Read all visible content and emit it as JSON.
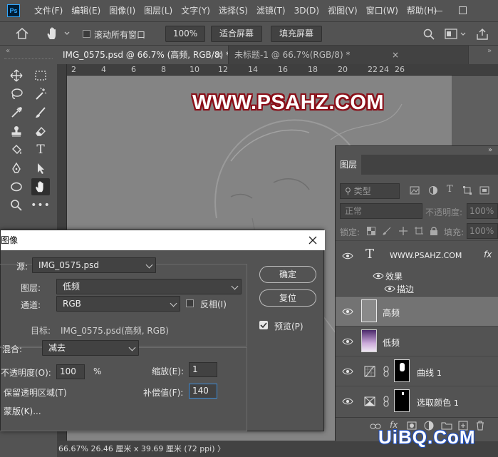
{
  "app": {
    "logo_text": "Ps",
    "menu": [
      "文件(F)",
      "编辑(E)",
      "图像(I)",
      "图层(L)",
      "文字(Y)",
      "选择(S)",
      "滤镜(T)",
      "3D(D)",
      "视图(V)",
      "窗口(W)",
      "帮助(H)"
    ]
  },
  "options_bar": {
    "scroll_all_label": "滚动所有窗口",
    "zoom_value": "100%",
    "fit_screen": "适合屏幕",
    "fill_screen": "填充屏幕"
  },
  "tabs": [
    {
      "label": "IMG_0575.psd @ 66.7% (高频, RGB/8) *"
    },
    {
      "label": "未标题-1 @ 66.7%(RGB/8) *"
    }
  ],
  "ruler": {
    "ticks": [
      "2",
      "4",
      "6",
      "8",
      "10",
      "12",
      "14",
      "16",
      "18",
      "20",
      "22",
      "24",
      "26"
    ]
  },
  "canvas": {
    "watermark": "WWW.PSAHZ.COM"
  },
  "status": {
    "text": "66.67%  26.46 厘米 x 39.69 厘米 (72 ppi)  〉"
  },
  "layers_panel": {
    "tab": "图层",
    "filter_kind": "类型",
    "blend_mode": "正常",
    "opacity_label": "不透明度:",
    "opacity_value": "100%",
    "lock_label": "锁定:",
    "fill_label": "填充:",
    "fill_value": "100%",
    "layers": [
      {
        "name": "WWW.PSAHZ.COM",
        "type": "text",
        "fx": "fx"
      },
      {
        "name": "高频",
        "type": "pixel",
        "selected": true
      },
      {
        "name": "低频",
        "type": "pixel"
      },
      {
        "name": "曲线",
        "suffix": "1",
        "type": "adjustment"
      },
      {
        "name": "选取颜色",
        "suffix": "1",
        "type": "adjustment"
      }
    ],
    "effects_label": "效果",
    "stroke_label": "描边"
  },
  "dialog": {
    "title": "图像",
    "source_label": "源:",
    "source_value": "IMG_0575.psd",
    "layer_label": "图层:",
    "layer_value": "低频",
    "channel_label": "通道:",
    "channel_value": "RGB",
    "invert_label": "反相(I)",
    "target_label": "目标:",
    "target_value": "IMG_0575.psd(高频, RGB)",
    "blending_label": "混合:",
    "blending_value": "减去",
    "opacity_label": "不透明度(O):",
    "opacity_value": "100",
    "percent": "%",
    "scale_label": "缩放(E):",
    "scale_value": "1",
    "preserve_label": "保留透明区域(T)",
    "offset_label": "补偿值(F):",
    "offset_value": "140",
    "mask_label": "蒙版(K)...",
    "ok_label": "确定",
    "reset_label": "复位",
    "preview_label": "预览(P)",
    "preview_checked": true
  },
  "corner_watermark": "UiBQ.CoM"
}
